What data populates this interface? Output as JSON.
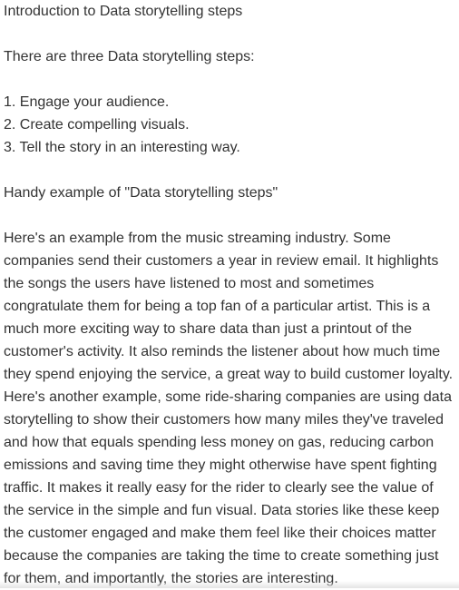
{
  "document": {
    "heading": "Introduction to Data storytelling steps",
    "intro": "There are three Data storytelling steps:",
    "steps": [
      "1. Engage your audience.",
      "2. Create compelling visuals.",
      "3. Tell the story in an interesting way."
    ],
    "example_heading": "Handy example of \"Data storytelling steps\"",
    "paragraph_lines": [
      "Here's an example from the music streaming industry. Some",
      "companies send their customers a year in review email. It highlights",
      "the songs the users have listened to most and sometimes",
      "congratulate them for being a top fan of a particular artist. This is a",
      "much more exciting way to share data than just a printout of the",
      "customer's activity. It also reminds the listener about how much time",
      "they spend enjoying the service, a great way to build customer loyalty.",
      "Here's another example, some ride-sharing companies are using data",
      "storytelling to show their customers how many miles they've traveled",
      "and how that equals spending less money on gas, reducing carbon",
      "emissions and saving time they might otherwise have spent fighting",
      "traffic. It makes it really easy for the rider to clearly see the value of",
      "the service in the simple and fun visual. Data stories like these keep",
      "the customer engaged and make them feel like their choices matter",
      "because the companies are taking the time to create something just",
      "for them, and importantly, the stories are interesting."
    ]
  }
}
